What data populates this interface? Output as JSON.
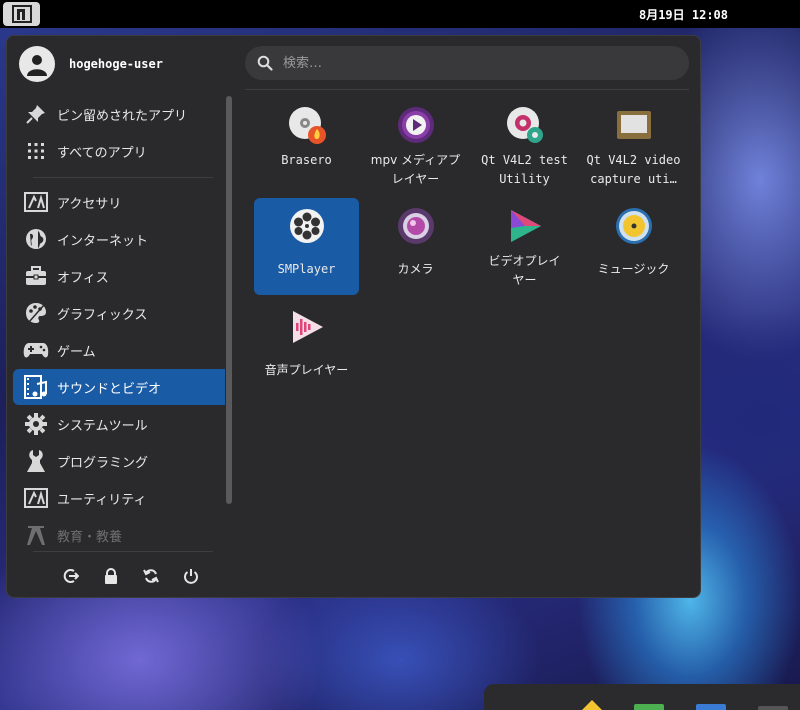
{
  "topbar": {
    "clock": "8月19日 12:08",
    "menu_icon": "distro-logo-icon"
  },
  "user": {
    "name": "hogehoge-user"
  },
  "search": {
    "placeholder": "検索…"
  },
  "sidebar": {
    "pinned": [
      {
        "label": "ピン留めされたアプリ",
        "icon": "pin-icon"
      },
      {
        "label": "すべてのアプリ",
        "icon": "grid-icon"
      }
    ],
    "categories": [
      {
        "label": "アクセサリ",
        "icon": "accessories-icon"
      },
      {
        "label": "インターネット",
        "icon": "globe-icon"
      },
      {
        "label": "オフィス",
        "icon": "briefcase-icon"
      },
      {
        "label": "グラフィックス",
        "icon": "palette-icon"
      },
      {
        "label": "ゲーム",
        "icon": "gamepad-icon"
      },
      {
        "label": "サウンドとビデオ",
        "icon": "film-music-icon",
        "active": true
      },
      {
        "label": "システムツール",
        "icon": "gear-icon"
      },
      {
        "label": "プログラミング",
        "icon": "wrench-icon"
      },
      {
        "label": "ユーティリティ",
        "icon": "utilities-icon"
      },
      {
        "label": "教育・教養",
        "icon": "education-icon"
      }
    ],
    "actions": [
      "logout-icon",
      "lock-icon",
      "restart-icon",
      "power-icon"
    ]
  },
  "apps": [
    {
      "label": "Brasero",
      "icon": "brasero-icon"
    },
    {
      "label": "mpv メディアプ\nレイヤー",
      "icon": "mpv-icon"
    },
    {
      "label": "Qt V4L2 test\nUtility",
      "icon": "qv4l2-icon"
    },
    {
      "label": "Qt V4L2 video\ncapture uti…",
      "icon": "qvidcap-icon"
    },
    {
      "label": "SMPlayer",
      "icon": "smplayer-icon",
      "selected": true
    },
    {
      "label": "カメラ",
      "icon": "camera-icon"
    },
    {
      "label": "ビデオプレイ\nヤー",
      "icon": "video-player-icon"
    },
    {
      "label": "ミュージック",
      "icon": "music-icon"
    },
    {
      "label": "音声プレイヤー",
      "icon": "audio-player-icon"
    }
  ],
  "colors": {
    "accent": "#1a5ba6",
    "menu_bg": "#2a2a2c"
  }
}
